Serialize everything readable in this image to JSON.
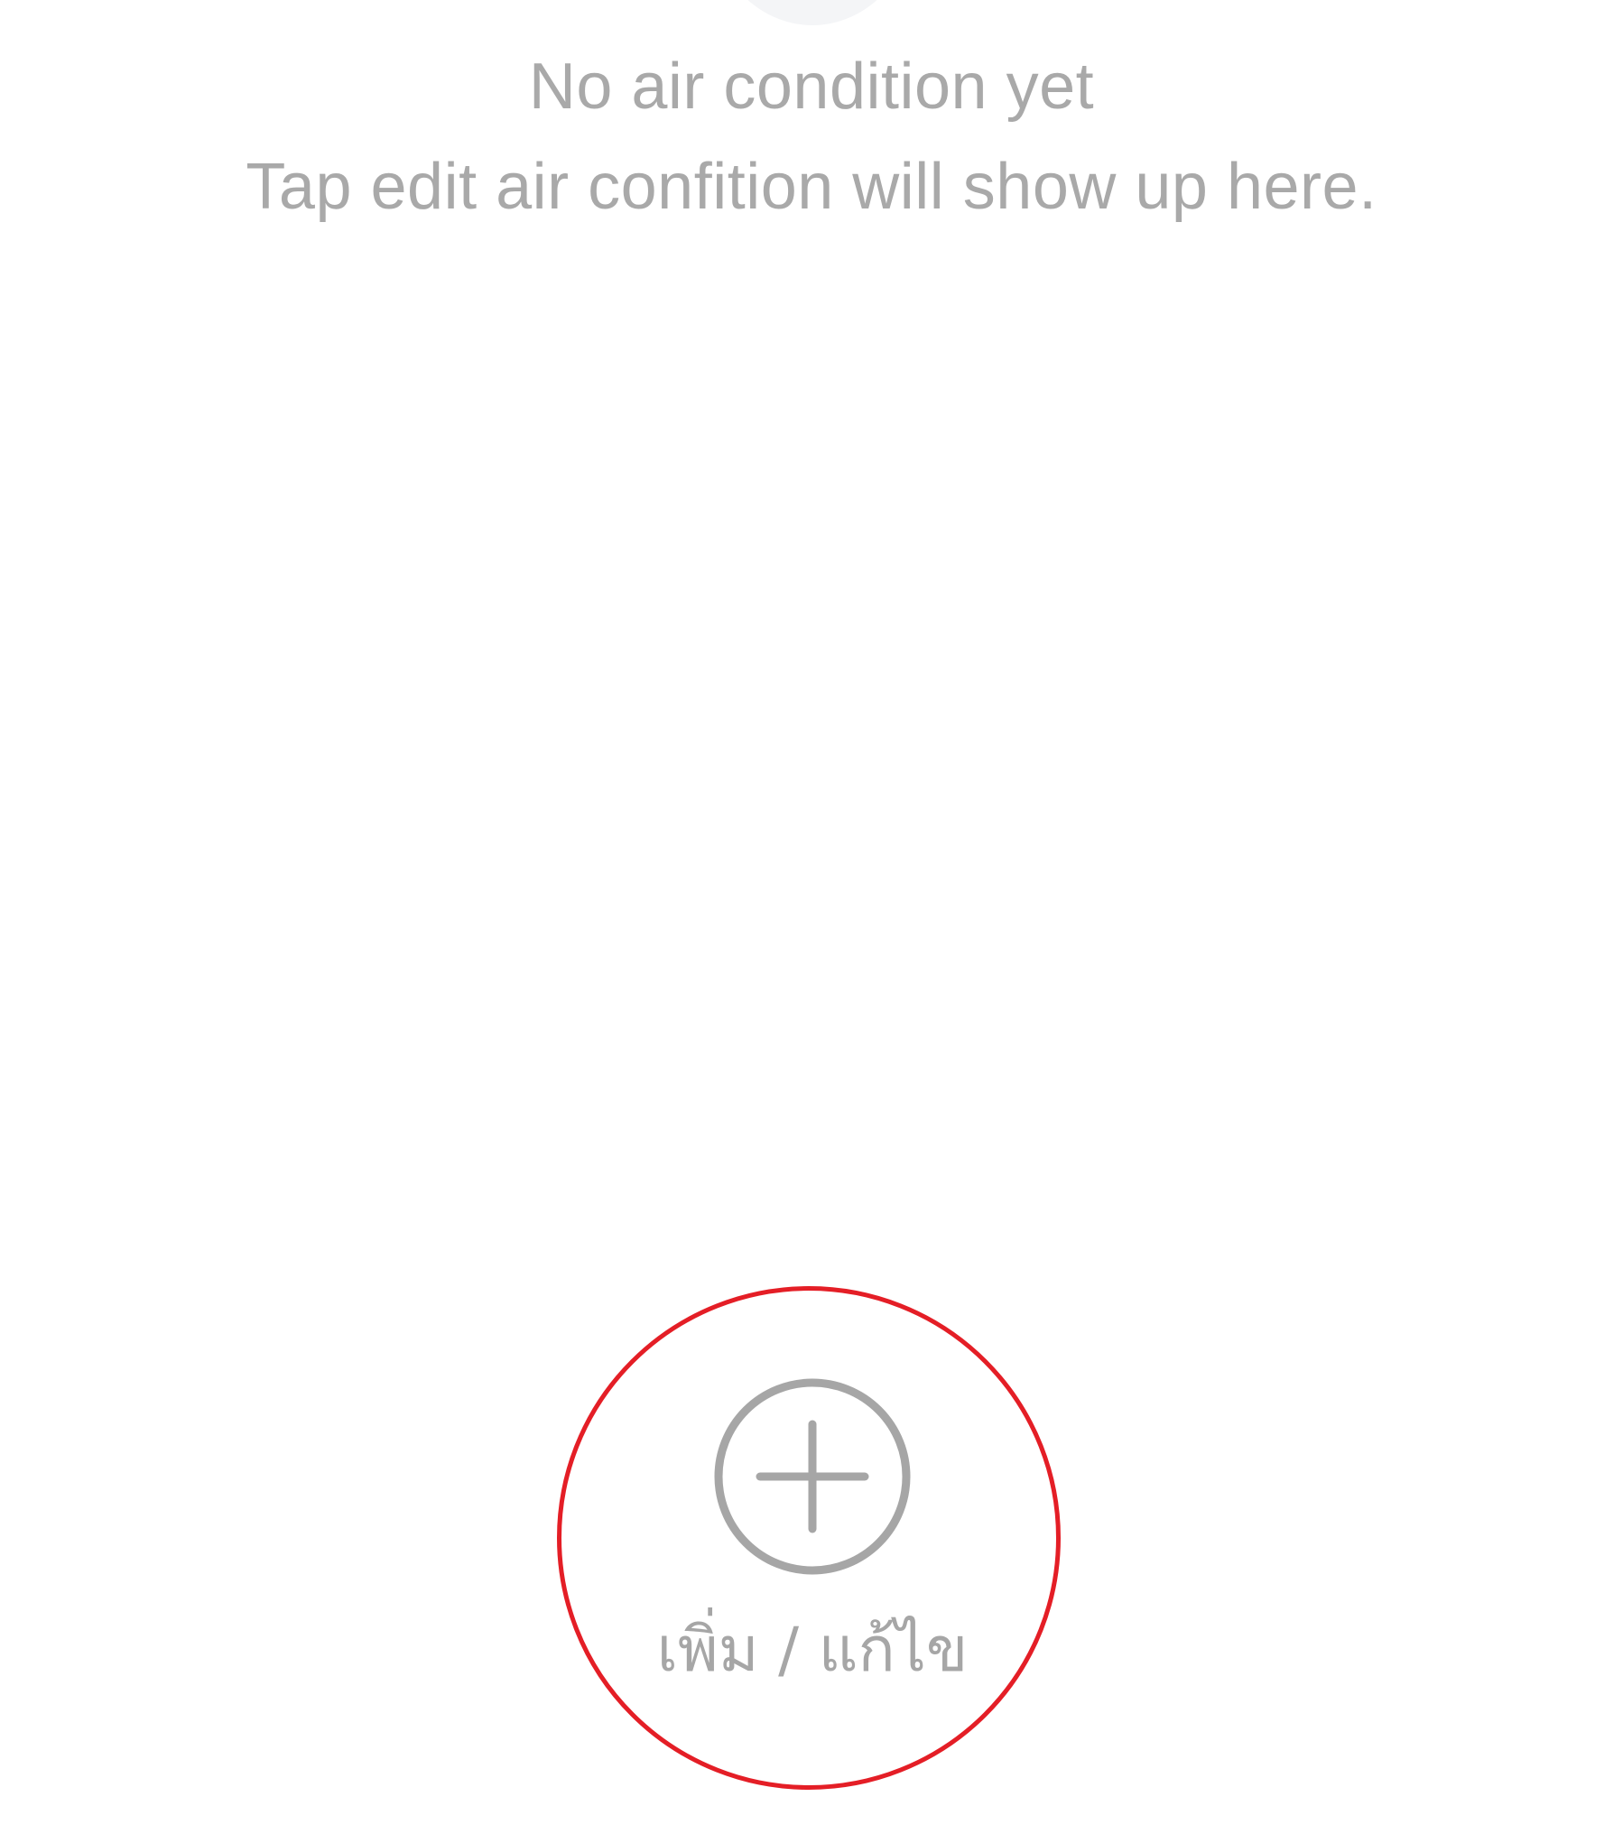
{
  "empty_state": {
    "title": "No air condition yet",
    "subtitle": "Tap edit air confition will show up here.",
    "illustration_icon": "placeholder-circle"
  },
  "add_edit_button": {
    "icon": "plus-circle-icon",
    "label": "เพิ่ม / แก้ไข"
  },
  "colors": {
    "text_muted": "#a9a9a9",
    "icon_gray": "#a6a6a6",
    "highlight_red": "#e41e26",
    "background": "#ffffff"
  }
}
